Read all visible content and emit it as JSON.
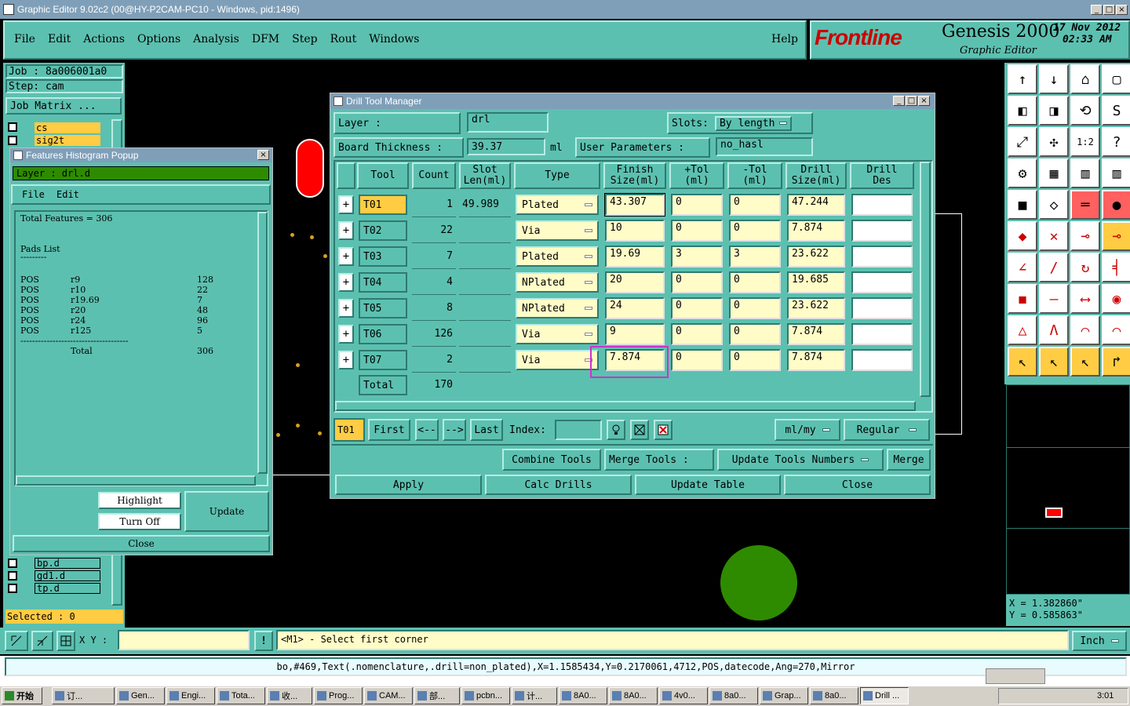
{
  "window": {
    "title": "Graphic Editor 9.02c2 (00@HY-P2CAM-PC10 - Windows, pid:1496)"
  },
  "menu": [
    "File",
    "Edit",
    "Actions",
    "Options",
    "Analysis",
    "DFM",
    "Step",
    "Rout",
    "Windows"
  ],
  "help_label": "Help",
  "brand": {
    "logo": "Frontline",
    "product": "Genesis 2000",
    "sub": "Graphic Editor",
    "date": "17 Nov 2012",
    "time": "02:33 AM"
  },
  "left": {
    "job": "Job : 8a006001a0",
    "step": "Step: cam",
    "job_matrix": "Job Matrix ...",
    "layers_top": [
      "cs",
      "sig2t"
    ],
    "layers_bottom": [
      "bp.d",
      "gd1.d",
      "tp.d"
    ],
    "selected": "Selected : 0"
  },
  "histogram": {
    "title": "Features Histogram Popup",
    "layer": "Layer :  drl.d",
    "menu_file": "File",
    "menu_edit": "Edit",
    "total_features": "Total Features = 306",
    "pads_list": "Pads List",
    "divider1": "---------",
    "rows": [
      {
        "type": "POS",
        "sym": "r9",
        "count": "128"
      },
      {
        "type": "POS",
        "sym": "r10",
        "count": "22"
      },
      {
        "type": "POS",
        "sym": "r19.69",
        "count": "7"
      },
      {
        "type": "POS",
        "sym": "r20",
        "count": "48"
      },
      {
        "type": "POS",
        "sym": "r24",
        "count": "96"
      },
      {
        "type": "POS",
        "sym": "r125",
        "count": "5"
      }
    ],
    "divider2": "-------------------------------------",
    "total_label": "Total",
    "total": "306",
    "highlight": "Highlight",
    "turn_off": "Turn Off",
    "update": "Update",
    "close": "Close"
  },
  "dtm": {
    "title": "Drill Tool Manager",
    "layer_label": "Layer          :",
    "layer_value": "drl",
    "slots_label": "Slots:",
    "slots_value": "By length",
    "board_thickness_label": "Board Thickness :",
    "board_thickness_value": "39.37",
    "board_thickness_unit": "ml",
    "user_params_label": "User Parameters :",
    "user_params_value": "no_hasl",
    "headers": {
      "tool": "Tool",
      "count": "Count",
      "slot1": "Slot",
      "slot2": "Len(ml)",
      "type": "Type",
      "finish1": "Finish",
      "finish2": "Size(ml)",
      "ptol1": "+Tol",
      "ptol2": "(ml)",
      "mtol1": "-Tol",
      "mtol2": "(ml)",
      "drill1": "Drill",
      "drill2": "Size(ml)",
      "des1": "Drill",
      "des2": "Des"
    },
    "rows": [
      {
        "tool": "T01",
        "count": "1",
        "slot": "49.989",
        "type": "Plated",
        "finish": "43.307",
        "ptol": "0",
        "mtol": "0",
        "drill": "47.244",
        "des": ""
      },
      {
        "tool": "T02",
        "count": "22",
        "slot": "",
        "type": "Via",
        "finish": "10",
        "ptol": "0",
        "mtol": "0",
        "drill": "7.874",
        "des": ""
      },
      {
        "tool": "T03",
        "count": "7",
        "slot": "",
        "type": "Plated",
        "finish": "19.69",
        "ptol": "3",
        "mtol": "3",
        "drill": "23.622",
        "des": ""
      },
      {
        "tool": "T04",
        "count": "4",
        "slot": "",
        "type": "NPlated",
        "finish": "20",
        "ptol": "0",
        "mtol": "0",
        "drill": "19.685",
        "des": ""
      },
      {
        "tool": "T05",
        "count": "8",
        "slot": "",
        "type": "NPlated",
        "finish": "24",
        "ptol": "0",
        "mtol": "0",
        "drill": "23.622",
        "des": ""
      },
      {
        "tool": "T06",
        "count": "126",
        "slot": "",
        "type": "Via",
        "finish": "9",
        "ptol": "0",
        "mtol": "0",
        "drill": "7.874",
        "des": ""
      },
      {
        "tool": "T07",
        "count": "2",
        "slot": "",
        "type": "Via",
        "finish": "7.874",
        "ptol": "0",
        "mtol": "0",
        "drill": "7.874",
        "des": ""
      }
    ],
    "total_label": "Total",
    "total_count": "170",
    "current_tool": "T01",
    "first": "First",
    "prev": "<--",
    "next": "-->",
    "last": "Last",
    "index_label": "Index:",
    "units": "ml/my",
    "mode": "Regular",
    "combine": "Combine Tools",
    "merge_tools": "Merge Tools  :",
    "update_numbers": "Update Tools Numbers",
    "merge": "Merge",
    "apply": "Apply",
    "calc": "Calc Drills",
    "update_table": "Update Table",
    "close": "Close"
  },
  "coords": {
    "x": "X = 1.382860\"",
    "y": "Y = 0.585863\""
  },
  "bottom": {
    "xy_label": "X Y :",
    "prompt": "<M1> - Select first corner",
    "units": "Inch",
    "status": "bo,#469,Text(.nomenclature,.drill=non_plated),X=1.1585434,Y=0.2170061,4712,POS,datecode,Ang=270,Mirror"
  },
  "taskbar": {
    "start": "开始",
    "items": [
      "订...",
      "Gen...",
      "Engi...",
      "Tota...",
      "收...",
      "Prog...",
      "CAM...",
      "部...",
      "pcbn...",
      "计...",
      "8A0...",
      "8A0...",
      "4v0...",
      "8a0...",
      "Grap...",
      "8a0...",
      "Drill ..."
    ],
    "clock": "3:01"
  },
  "colors": {
    "teal": "#5cc0b0",
    "yellow": "#fffcc8",
    "orange": "#ffcc44",
    "highlight_rect": "#cc33cc",
    "green_layer": "#2e8b00"
  }
}
